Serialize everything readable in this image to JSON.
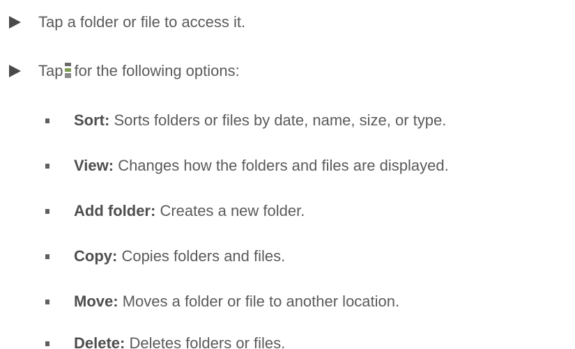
{
  "steps": [
    {
      "text": "Tap a folder or file to access it."
    },
    {
      "text_before": "Tap",
      "text_after": "for the following options:"
    }
  ],
  "icon": "overflow-menu-icon",
  "options": [
    {
      "term": "Sort:",
      "desc": "Sorts folders or files by date, name, size, or type."
    },
    {
      "term": "View:",
      "desc": "Changes how the folders and files are displayed."
    },
    {
      "term": "Add folder:",
      "desc": "Creates a new folder."
    },
    {
      "term": "Copy:",
      "desc": "Copies folders and files."
    },
    {
      "term": "Move:",
      "desc": "Moves a folder or file to another location."
    },
    {
      "term": "Delete:",
      "desc": "Deletes folders or files."
    }
  ]
}
